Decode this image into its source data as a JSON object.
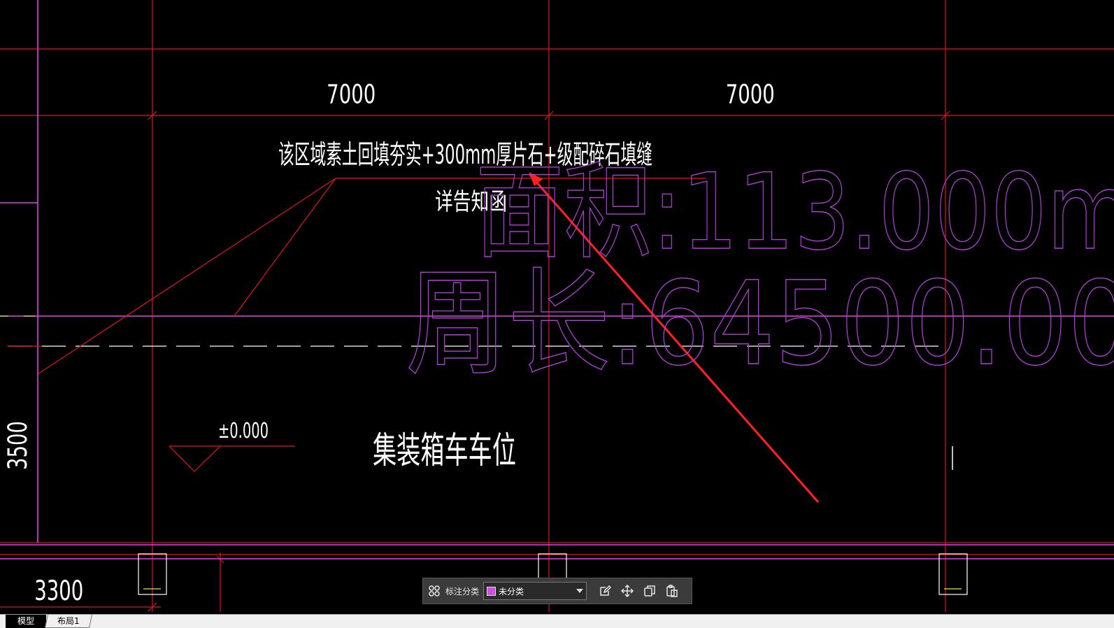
{
  "drawing": {
    "dimensions": {
      "span_left": "7000",
      "span_right": "7000",
      "height_left": "3500",
      "bottom_left": "3300"
    },
    "notes": {
      "backfill_line1": "该区域素土回填夯实+300mm厚片石+级配碎石填缝",
      "backfill_line2": "详告知函",
      "elevation": "±0.000",
      "zone_label": "集装箱车车位"
    },
    "measure_overlay": {
      "area_text": "面积:113.000m",
      "perimeter_text": "周长:64500.00"
    },
    "colors": {
      "grid_red": "#e0151b",
      "wall_magenta": "#e040e8",
      "measure_violet": "#b23fd9",
      "text_white": "#ffffff",
      "arrow_red": "#ff2020"
    }
  },
  "toolbar": {
    "label": "标注分类",
    "category_value": "未分类",
    "category_color": "#d04ee0",
    "icons": [
      "grid-icon",
      "edit-icon",
      "move-icon",
      "copy-icon",
      "paste-icon"
    ]
  },
  "tabs": {
    "model": "模型",
    "layout1": "布局1"
  }
}
